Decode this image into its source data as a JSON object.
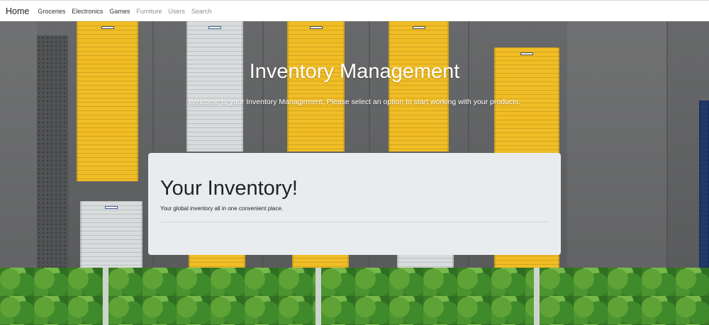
{
  "navbar": {
    "brand": "Home",
    "links": [
      {
        "label": "Groceries",
        "state": "active"
      },
      {
        "label": "Electronics",
        "state": "active"
      },
      {
        "label": "Games",
        "state": "active"
      },
      {
        "label": "Furniture",
        "state": "muted"
      },
      {
        "label": "Users",
        "state": "muted"
      },
      {
        "label": "Search",
        "state": "muted"
      }
    ]
  },
  "hero": {
    "title": "Inventory Management",
    "subtitle": "Welcome to your Inventory Management. Please select an option to start working with your products."
  },
  "card": {
    "title": "Your Inventory!",
    "lead": "Your global inventory all in one convenient place."
  },
  "colors": {
    "unit_yellow": "#f1bd25",
    "unit_white": "#d9dcdd",
    "card_bg": "#e9ecef",
    "nav_muted": "#8f8f8f"
  }
}
